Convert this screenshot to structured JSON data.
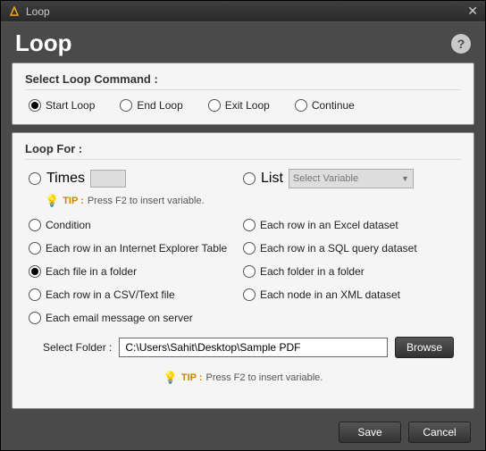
{
  "titlebar": {
    "title": "Loop"
  },
  "header": {
    "title": "Loop"
  },
  "section1": {
    "title": "Select Loop Command :",
    "options": {
      "start": "Start Loop",
      "end": "End Loop",
      "exit": "Exit Loop",
      "cont": "Continue"
    },
    "selected": "start"
  },
  "section2": {
    "title": "Loop For :",
    "times_label": "Times",
    "list_label": "List",
    "list_placeholder": "Select Variable",
    "tip_label": "TIP :",
    "tip_text": "Press F2 to insert variable.",
    "options": {
      "condition": "Condition",
      "excel": "Each row in an Excel dataset",
      "ietable": "Each row in an Internet Explorer Table",
      "sql": "Each row in a SQL query dataset",
      "folder": "Each file in a folder",
      "eachfolder": "Each folder in a folder",
      "csv": "Each row in a CSV/Text file",
      "xml": "Each node in an XML dataset",
      "email": "Each email message on server"
    },
    "selected": "folder"
  },
  "folder": {
    "label": "Select Folder :",
    "value": "C:\\Users\\Sahit\\Desktop\\Sample PDF",
    "browse": "Browse"
  },
  "footer": {
    "save": "Save",
    "cancel": "Cancel"
  }
}
